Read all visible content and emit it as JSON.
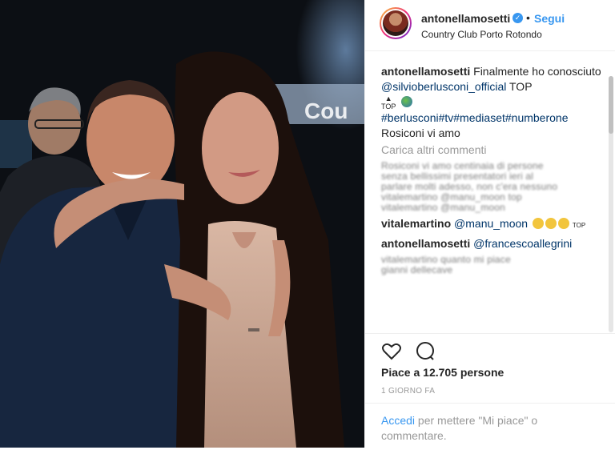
{
  "post": {
    "username": "antonellamosetti",
    "verified_icon": "verified-badge-icon",
    "follow_label": "Segui",
    "dot": "•",
    "location": "Country Club Porto Rotondo"
  },
  "caption": {
    "username": "antonellamosetti",
    "text_before": "Finalmente ho conosciuto",
    "mention": "@silvioberlusconi_official",
    "text_after": "TOP",
    "top_label": "TOP",
    "hashtags": "#berlusconi#tv#mediaset#numberone",
    "line3": "Rosiconi vi amo"
  },
  "load_more": "Carica altri commenti",
  "comments": [
    {
      "username": "vitalemartino",
      "mention": "@manu_moon",
      "suffix": "TOP"
    },
    {
      "username": "antonellamosetti",
      "mention": "@francescoallegrini",
      "suffix": ""
    },
    {
      "username": "gianni dellecave",
      "mention": "",
      "suffix": ""
    }
  ],
  "blurred_text": "Rosiconi vi amo  centinaia di persone\nsenza bellissimi presentatori ieri al\nparlare molti adesso, non c'era nessuno\nvitalemartino @manu_moon top\nvitalemartino @manu_moon",
  "blurred_text2": "vitalemartino quanto mi piace\ngianni dellecave",
  "likes": "Piace a 12.705 persone",
  "time": "1 GIORNO FA",
  "login": {
    "link": "Accedi",
    "text": "per mettere \"Mi piace\" o commentare."
  },
  "photo_sign": "Cou",
  "colors": {
    "accent": "#3897f0",
    "link": "#003569",
    "muted": "#999999"
  }
}
